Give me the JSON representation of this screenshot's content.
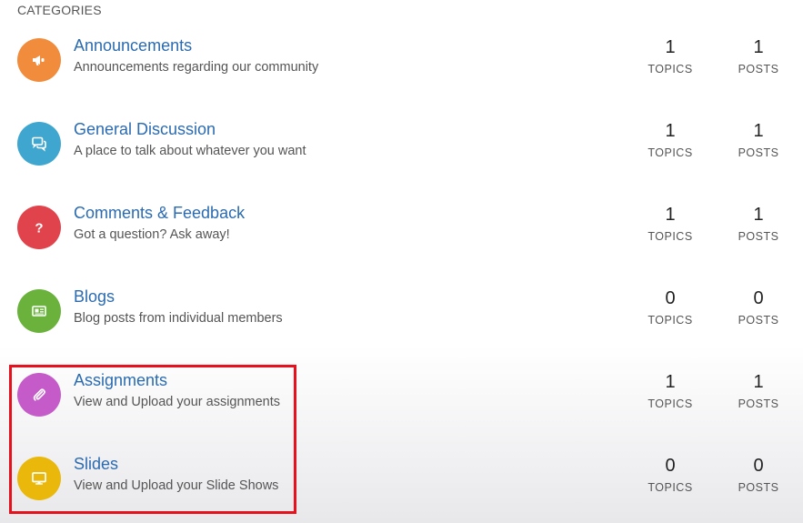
{
  "header": {
    "title": "CATEGORIES"
  },
  "categories": [
    {
      "title": "Announcements",
      "description": "Announcements regarding our community",
      "topics": "1",
      "topics_label": "TOPICS",
      "posts": "1",
      "posts_label": "POSTS",
      "icon": "megaphone-icon",
      "color": "#f08c3b"
    },
    {
      "title": "General Discussion",
      "description": "A place to talk about whatever you want",
      "topics": "1",
      "topics_label": "TOPICS",
      "posts": "1",
      "posts_label": "POSTS",
      "icon": "chat-bubbles-icon",
      "color": "#3fa7cf"
    },
    {
      "title": "Comments & Feedback",
      "description": "Got a question? Ask away!",
      "topics": "1",
      "topics_label": "TOPICS",
      "posts": "1",
      "posts_label": "POSTS",
      "icon": "question-mark-icon",
      "color": "#e0434b"
    },
    {
      "title": "Blogs",
      "description": "Blog posts from individual members",
      "topics": "0",
      "topics_label": "TOPICS",
      "posts": "0",
      "posts_label": "POSTS",
      "icon": "newspaper-icon",
      "color": "#6ab23c"
    },
    {
      "title": "Assignments",
      "description": "View and Upload your assignments",
      "topics": "1",
      "topics_label": "TOPICS",
      "posts": "1",
      "posts_label": "POSTS",
      "icon": "paperclip-icon",
      "color": "#c55bc8"
    },
    {
      "title": "Slides",
      "description": "View and Upload your Slide Shows",
      "topics": "0",
      "topics_label": "TOPICS",
      "posts": "0",
      "posts_label": "POSTS",
      "icon": "monitor-icon",
      "color": "#e9b80a"
    }
  ],
  "highlight": {
    "color": "#e8101c"
  }
}
